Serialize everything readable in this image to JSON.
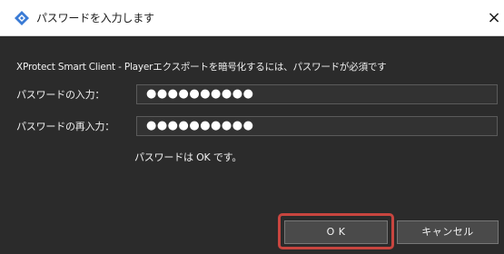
{
  "dialog": {
    "title": "パスワードを入力します",
    "close_glyph": "×",
    "app_icon": "diamond-app-icon",
    "message": "XProtect Smart Client - Playerエクスポートを暗号化するには、パスワードが必須です",
    "fields": [
      {
        "label": "パスワードの入力：",
        "value": "●●●●●●●●●●"
      },
      {
        "label": "パスワードの再入力：",
        "value": "●●●●●●●●●●"
      }
    ],
    "status": "パスワードは OK です。",
    "buttons": {
      "ok": "O K",
      "cancel": "キャンセル"
    }
  },
  "colors": {
    "background": "#2b2b2b",
    "titlebar": "#ffffff",
    "accent_icon": "#3a7bd5",
    "highlight": "#c8453f"
  }
}
